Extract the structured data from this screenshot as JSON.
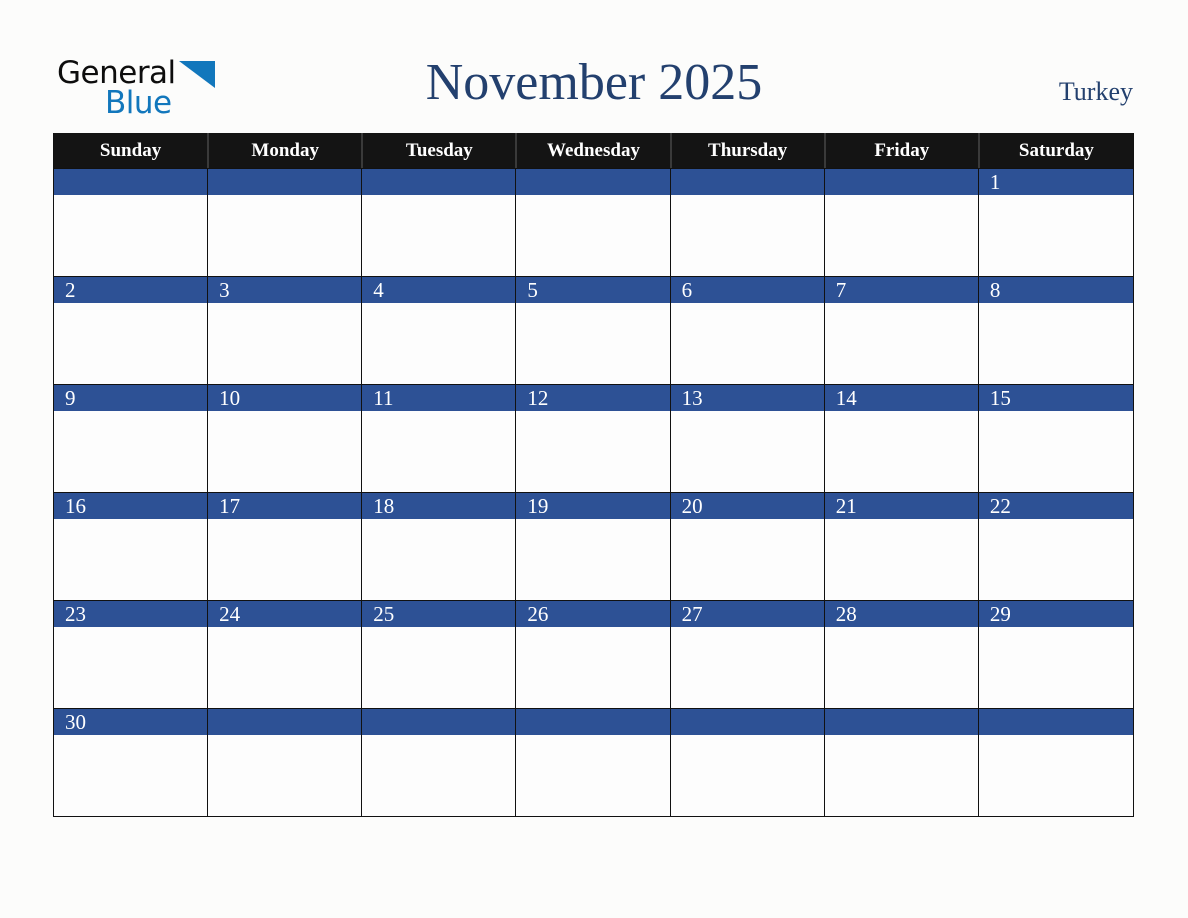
{
  "brand": {
    "name_part1": "General",
    "name_part2": "Blue",
    "triangle_color": "#1277bc",
    "text_color": "#0d0d0d"
  },
  "header": {
    "title": "November 2025",
    "country": "Turkey",
    "title_color": "#23406e"
  },
  "calendar": {
    "weekdays": [
      "Sunday",
      "Monday",
      "Tuesday",
      "Wednesday",
      "Thursday",
      "Friday",
      "Saturday"
    ],
    "header_bg": "#141414",
    "banner_bg": "#2d5195",
    "cell_bg": "#fdfdfd",
    "border_color": "#111111",
    "weeks": [
      {
        "days": [
          "",
          "",
          "",
          "",
          "",
          "",
          "1"
        ]
      },
      {
        "days": [
          "2",
          "3",
          "4",
          "5",
          "6",
          "7",
          "8"
        ]
      },
      {
        "days": [
          "9",
          "10",
          "11",
          "12",
          "13",
          "14",
          "15"
        ]
      },
      {
        "days": [
          "16",
          "17",
          "18",
          "19",
          "20",
          "21",
          "22"
        ]
      },
      {
        "days": [
          "23",
          "24",
          "25",
          "26",
          "27",
          "28",
          "29"
        ]
      },
      {
        "days": [
          "30",
          "",
          "",
          "",
          "",
          "",
          ""
        ]
      }
    ]
  }
}
